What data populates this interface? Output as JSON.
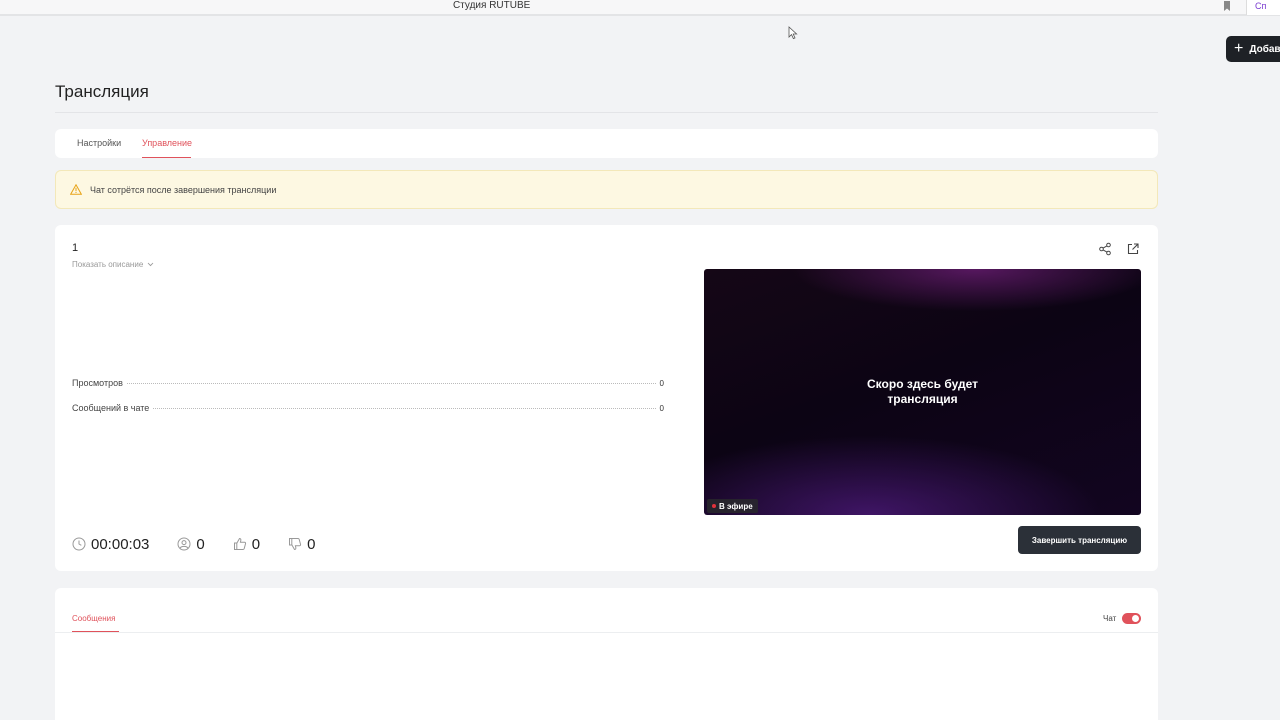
{
  "browser": {
    "tab_title": "Студия RUTUBE",
    "extension_tab_label": "Сп"
  },
  "header": {
    "add_button_label": "Добав",
    "page_title": "Трансляция"
  },
  "tabs": [
    {
      "label": "Настройки",
      "active": false
    },
    {
      "label": "Управление",
      "active": true
    }
  ],
  "notice": {
    "text": "Чат сотрётся после завершения трансляции",
    "icon": "warning-icon"
  },
  "stream": {
    "name": "1",
    "show_description_label": "Показать описание",
    "stats": [
      {
        "label": "Просмотров",
        "value": "0"
      },
      {
        "label": "Сообщений в чате",
        "value": "0"
      }
    ],
    "player": {
      "placeholder_line1": "Скоро здесь будет",
      "placeholder_line2": "трансляция",
      "live_badge": "В эфире"
    },
    "metrics": {
      "duration": "00:00:03",
      "viewers": "0",
      "likes": "0",
      "dislikes": "0"
    },
    "end_button_label": "Завершить трансляцию"
  },
  "chat_panel": {
    "tab_label": "Сообщения",
    "chat_toggle_label": "Чат",
    "chat_enabled": true
  },
  "colors": {
    "accent": "#e0525b",
    "dark_button": "#2b3038",
    "notice_bg": "#fdf8e2"
  }
}
